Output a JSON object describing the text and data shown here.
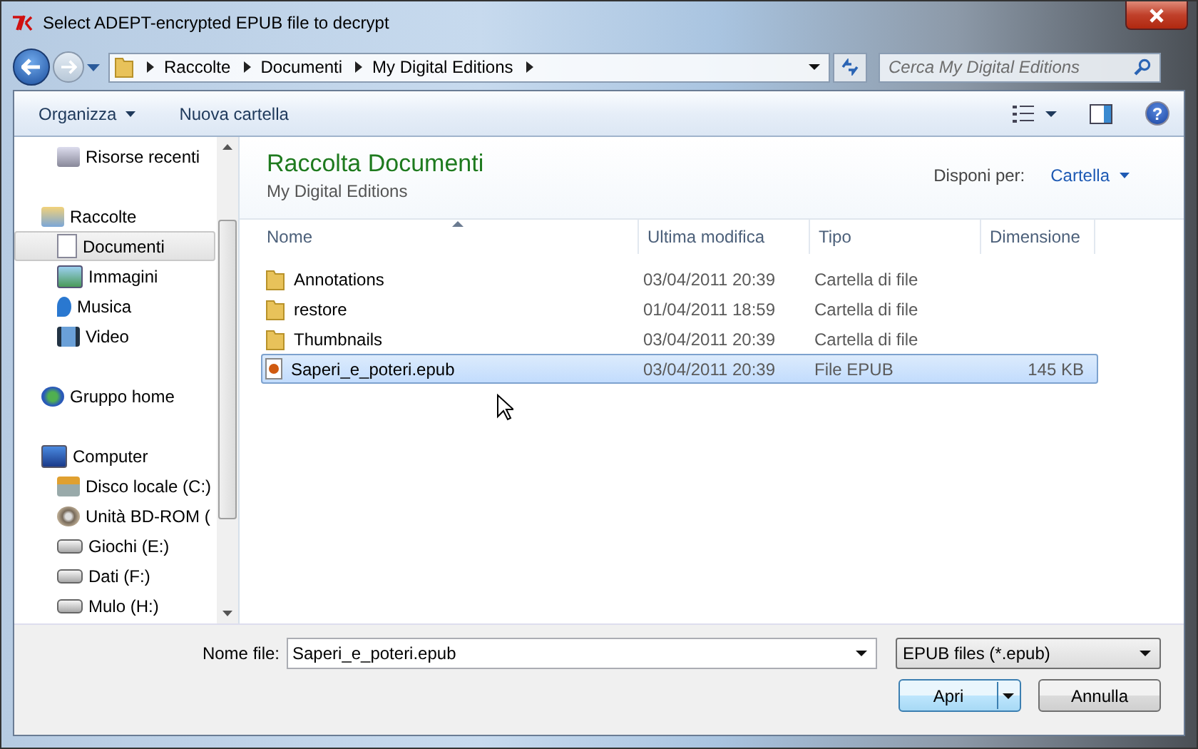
{
  "window": {
    "title": "Select ADEPT-encrypted EPUB file to decrypt"
  },
  "navigation": {
    "breadcrumb": [
      "Raccolte",
      "Documenti",
      "My Digital Editions"
    ],
    "search": {
      "placeholder": "Cerca My Digital Editions"
    }
  },
  "toolbar": {
    "buttons": [
      {
        "label": "Organizza",
        "dropdown": true
      },
      {
        "label": "Nuova cartella",
        "dropdown": false
      }
    ],
    "help_icon": "?"
  },
  "sidebar": {
    "sections": [
      {
        "children": [
          {
            "label": "Risorse recenti",
            "kind": "recent",
            "selected": false
          }
        ]
      },
      {
        "label": "Raccolte",
        "kind": "library",
        "children": [
          {
            "label": "Documenti",
            "kind": "document",
            "selected": true
          },
          {
            "label": "Immagini",
            "kind": "picture",
            "selected": false
          },
          {
            "label": "Musica",
            "kind": "music",
            "selected": false
          },
          {
            "label": "Video",
            "kind": "film",
            "selected": false
          }
        ]
      },
      {
        "label": "Gruppo home",
        "kind": "homegroup"
      },
      {
        "label": "Computer",
        "kind": "computer",
        "children": [
          {
            "label": "Disco locale (C:)",
            "kind": "system-drive",
            "selected": false
          },
          {
            "label": "Unità BD-ROM (",
            "kind": "disc",
            "selected": false
          },
          {
            "label": "Giochi (E:)",
            "kind": "drive",
            "selected": false
          },
          {
            "label": "Dati (F:)",
            "kind": "drive",
            "selected": false
          },
          {
            "label": "Mulo (H:)",
            "kind": "drive",
            "selected": false
          }
        ]
      }
    ]
  },
  "library": {
    "title": "Raccolta Documenti",
    "subtitle": "My Digital Editions",
    "arrange_label": "Disponi per:",
    "arrange_value": "Cartella"
  },
  "table": {
    "columns": [
      {
        "label": "Nome",
        "sorted": true
      },
      {
        "label": "Ultima modifica",
        "sorted": false
      },
      {
        "label": "Tipo",
        "sorted": false
      },
      {
        "label": "Dimensione",
        "sorted": false
      }
    ],
    "rows": [
      {
        "kind": "folder",
        "name": "Annotations",
        "modified": "03/04/2011 20:39",
        "type": "Cartella di file",
        "selected": false
      },
      {
        "kind": "folder",
        "name": "restore",
        "modified": "01/04/2011 18:59",
        "type": "Cartella di file",
        "selected": false
      },
      {
        "kind": "folder",
        "name": "Thumbnails",
        "modified": "03/04/2011 20:39",
        "type": "Cartella di file",
        "selected": false
      },
      {
        "kind": "epub",
        "name": "Saperi_e_poteri.epub",
        "modified": "03/04/2011 20:39",
        "type": "File EPUB",
        "size": "145 KB",
        "selected": true
      }
    ]
  },
  "footer": {
    "filename_label": "Nome file:",
    "filename": "Saperi_e_poteri.epub",
    "filter": "EPUB files (*.epub)",
    "buttons": [
      {
        "label": "Apri",
        "kind": "split"
      },
      {
        "label": "Annulla",
        "kind": "plain"
      }
    ]
  }
}
